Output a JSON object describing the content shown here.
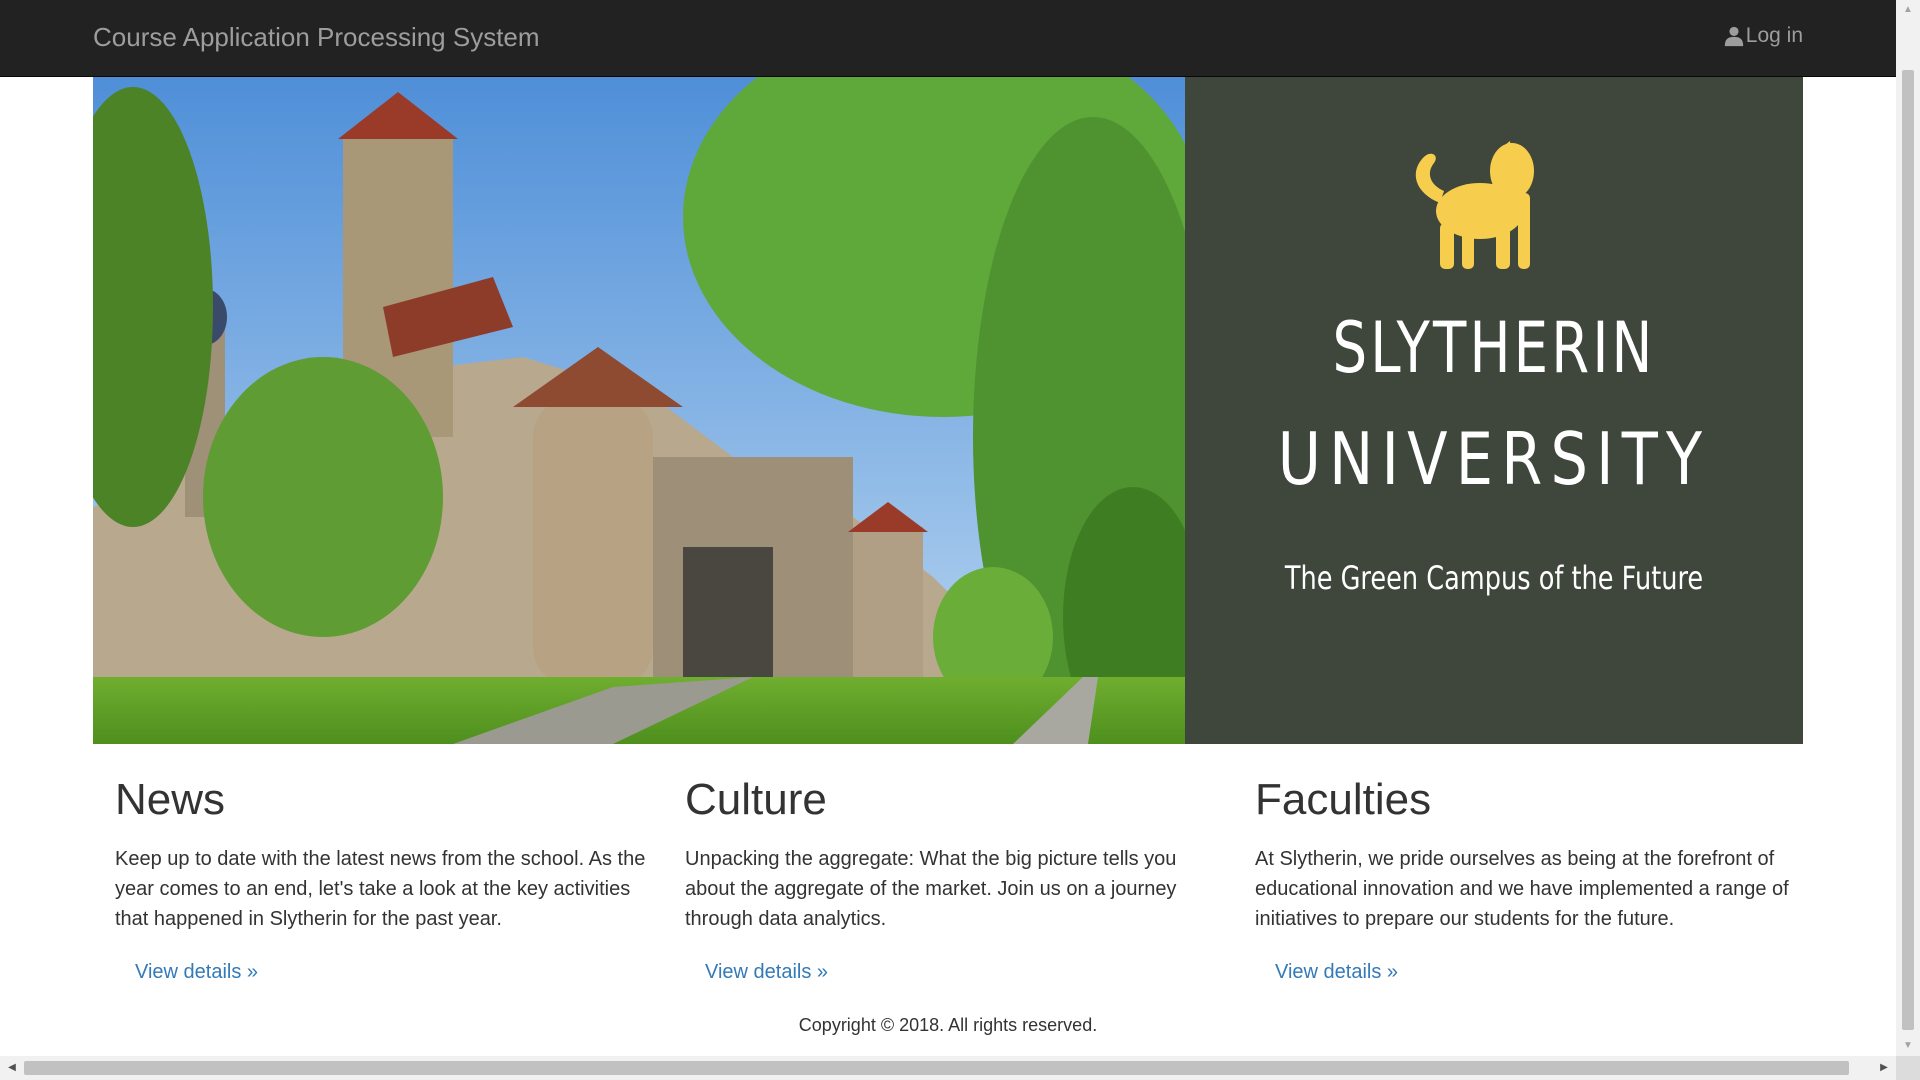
{
  "navbar": {
    "brand": "Course Application Processing System",
    "login_label": "Log in",
    "login_icon": "user-icon"
  },
  "hero": {
    "photo_description_icon": "castle-photo",
    "logo_icon": "lion-icon",
    "title_line1": "SLYTHERIN",
    "title_line2": "UNIVERSITY",
    "tagline": "The Green Campus of the Future",
    "panel_color": "#3f473d",
    "logo_color": "#f7cd4e"
  },
  "sections": [
    {
      "title": "News",
      "body": "Keep up to date with the latest news from the school. As the year comes to an end, let's take a look at the key activities that happened in Slytherin for the past year.",
      "link": "View details »"
    },
    {
      "title": "Culture",
      "body": "Unpacking the aggregate: What the big picture tells you about the aggregate of the market. Join us on a journey through data analytics.",
      "link": "View details »"
    },
    {
      "title": "Faculties",
      "body": "At Slytherin, we pride ourselves as being at the forefront of educational innovation and we have implemented a range of initiatives to prepare our students for the future.",
      "link": "View details »"
    }
  ],
  "footer": {
    "copyright": "Copyright © 2018. All rights reserved."
  },
  "colors": {
    "navbar_bg": "#222222",
    "link": "#337ab7"
  }
}
